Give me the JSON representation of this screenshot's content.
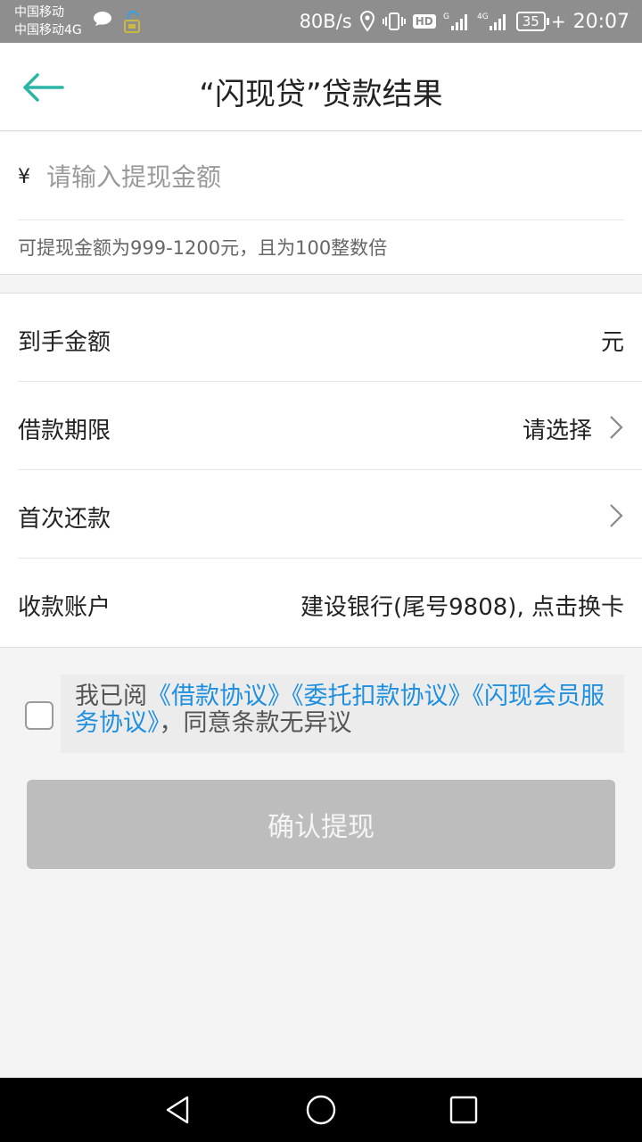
{
  "status_bar": {
    "carrier_1": "中国移动",
    "carrier_2": "中国移动4G",
    "net_speed": "80B/s",
    "hd_label": "HD",
    "battery": "35",
    "time": "20:07"
  },
  "header": {
    "title": "“闪现贷”贷款结果"
  },
  "amount": {
    "currency_symbol": "¥",
    "placeholder": "请输入提现金额",
    "value": "",
    "hint": "可提现金额为999-1200元，且为100整数倍"
  },
  "rows": [
    {
      "label": "到手金额",
      "value": "元"
    },
    {
      "label": "借款期限",
      "value": "请选择"
    },
    {
      "label": "首次还款",
      "value": ""
    },
    {
      "label": "收款账户",
      "value": "建设银行(尾号9808), 点击换卡"
    }
  ],
  "agreement": {
    "checked": false,
    "prefix": "我已阅",
    "link_1": "《借款协议》",
    "link_2": "《委托扣款协议》",
    "link_3": "《闪现会员服务协议》",
    "suffix": "，同意条款无异议"
  },
  "confirm_button": "确认提现",
  "colors": {
    "accent": "#2bb5a5",
    "link": "#1f8fe0",
    "button_disabled": "#bdbdbd",
    "status_bar": "#8e8e8e"
  },
  "icons": {
    "back": "arrow-left-icon",
    "chevron": "chevron-right-icon",
    "nav_back": "triangle-back-icon",
    "nav_home": "circle-home-icon",
    "nav_recent": "square-recent-icon"
  }
}
